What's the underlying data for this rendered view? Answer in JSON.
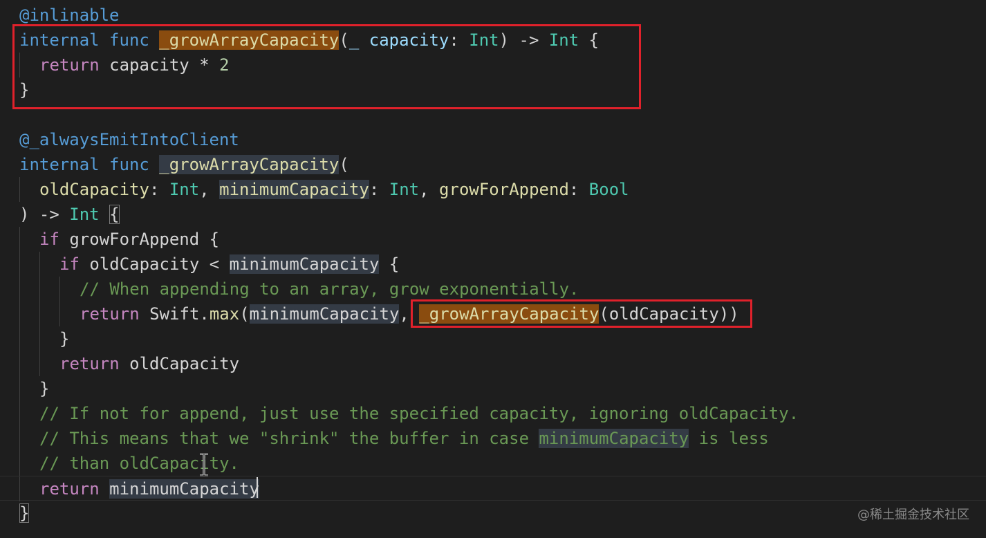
{
  "editor": {
    "lines": [
      {
        "tokens": [
          {
            "text": "@inlinable",
            "cls": "deco"
          }
        ]
      },
      {
        "tokens": [
          {
            "text": "internal",
            "cls": "kw"
          },
          {
            "text": " "
          },
          {
            "text": "func",
            "cls": "kw"
          },
          {
            "text": " "
          },
          {
            "text": "_growArrayCapacity",
            "cls": "fn",
            "hl": "orange"
          },
          {
            "text": "(",
            "cls": "punc"
          },
          {
            "text": "_",
            "cls": "var"
          },
          {
            "text": " "
          },
          {
            "text": "capacity",
            "cls": "var"
          },
          {
            "text": ": ",
            "cls": "punc"
          },
          {
            "text": "Int",
            "cls": "type"
          },
          {
            "text": ") -> ",
            "cls": "punc"
          },
          {
            "text": "Int",
            "cls": "type"
          },
          {
            "text": " {",
            "cls": "punc"
          }
        ]
      },
      {
        "indent": 1,
        "tokens": [
          {
            "text": "return",
            "cls": "ctrl"
          },
          {
            "text": " capacity ",
            "cls": "plain"
          },
          {
            "text": "*",
            "cls": "plain"
          },
          {
            "text": " "
          },
          {
            "text": "2",
            "cls": "num"
          }
        ]
      },
      {
        "tokens": [
          {
            "text": "}",
            "cls": "punc"
          }
        ]
      },
      {
        "tokens": []
      },
      {
        "tokens": [
          {
            "text": "@_alwaysEmitIntoClient",
            "cls": "deco"
          }
        ]
      },
      {
        "tokens": [
          {
            "text": "internal",
            "cls": "kw"
          },
          {
            "text": " "
          },
          {
            "text": "func",
            "cls": "kw"
          },
          {
            "text": " "
          },
          {
            "text": "_growArrayCapacity",
            "cls": "fn",
            "hl": "grey"
          },
          {
            "text": "(",
            "cls": "punc"
          }
        ]
      },
      {
        "indent": 1,
        "tokens": [
          {
            "text": "oldCapacity",
            "cls": "fn"
          },
          {
            "text": ": ",
            "cls": "punc"
          },
          {
            "text": "Int",
            "cls": "type"
          },
          {
            "text": ", ",
            "cls": "punc"
          },
          {
            "text": "minimumCapacity",
            "cls": "fn",
            "hl": "grey"
          },
          {
            "text": ": ",
            "cls": "punc"
          },
          {
            "text": "Int",
            "cls": "type"
          },
          {
            "text": ", ",
            "cls": "punc"
          },
          {
            "text": "growForAppend",
            "cls": "fn"
          },
          {
            "text": ": ",
            "cls": "punc"
          },
          {
            "text": "Bool",
            "cls": "type"
          }
        ]
      },
      {
        "tokens": [
          {
            "text": ") -> ",
            "cls": "punc"
          },
          {
            "text": "Int",
            "cls": "type"
          },
          {
            "text": " "
          },
          {
            "text": "{",
            "cls": "punc",
            "match": true
          }
        ]
      },
      {
        "indent": 1,
        "tokens": [
          {
            "text": "if",
            "cls": "ctrl"
          },
          {
            "text": " growForAppend {",
            "cls": "plain"
          }
        ]
      },
      {
        "indent": 2,
        "tokens": [
          {
            "text": "if",
            "cls": "ctrl"
          },
          {
            "text": " oldCapacity < ",
            "cls": "plain"
          },
          {
            "text": "minimumCapacity",
            "cls": "plain",
            "hl": "grey"
          },
          {
            "text": " {",
            "cls": "plain"
          }
        ]
      },
      {
        "indent": 3,
        "tokens": [
          {
            "text": "// When appending to an array, grow exponentially.",
            "cls": "cmt"
          }
        ]
      },
      {
        "indent": 3,
        "tokens": [
          {
            "text": "return",
            "cls": "ctrl"
          },
          {
            "text": " Swift.",
            "cls": "plain"
          },
          {
            "text": "max",
            "cls": "fn"
          },
          {
            "text": "(",
            "cls": "punc"
          },
          {
            "text": "minimumCapacity",
            "cls": "plain",
            "hl": "grey"
          },
          {
            "text": ", ",
            "cls": "punc"
          },
          {
            "text": "_growArrayCapacity",
            "cls": "fn",
            "hl": "orange"
          },
          {
            "text": "(oldCapacity))",
            "cls": "plain"
          }
        ]
      },
      {
        "indent": 2,
        "tokens": [
          {
            "text": "}",
            "cls": "punc"
          }
        ]
      },
      {
        "indent": 2,
        "tokens": [
          {
            "text": "return",
            "cls": "ctrl"
          },
          {
            "text": " oldCapacity",
            "cls": "plain"
          }
        ]
      },
      {
        "indent": 1,
        "tokens": [
          {
            "text": "}",
            "cls": "punc"
          }
        ]
      },
      {
        "indent": 1,
        "tokens": [
          {
            "text": "// If not for append, just use the specified capacity, ignoring oldCapacity.",
            "cls": "cmt"
          }
        ]
      },
      {
        "indent": 1,
        "tokens": [
          {
            "text": "// This means that we \"shrink\" the buffer in case ",
            "cls": "cmt"
          },
          {
            "text": "minimumCapacity",
            "cls": "cmt",
            "hl": "grey"
          },
          {
            "text": " is less",
            "cls": "cmt"
          }
        ]
      },
      {
        "indent": 1,
        "tokens": [
          {
            "text": "// than oldCapacity.",
            "cls": "cmt"
          }
        ]
      },
      {
        "indent": 1,
        "current": true,
        "tokens": [
          {
            "text": "return",
            "cls": "ctrl"
          },
          {
            "text": " "
          },
          {
            "text": "minimumCapacity",
            "cls": "plain",
            "hl": "grey"
          }
        ]
      },
      {
        "tokens": [
          {
            "text": "}",
            "cls": "punc",
            "match": true
          }
        ]
      }
    ]
  },
  "watermark": "@稀土掘金技术社区"
}
